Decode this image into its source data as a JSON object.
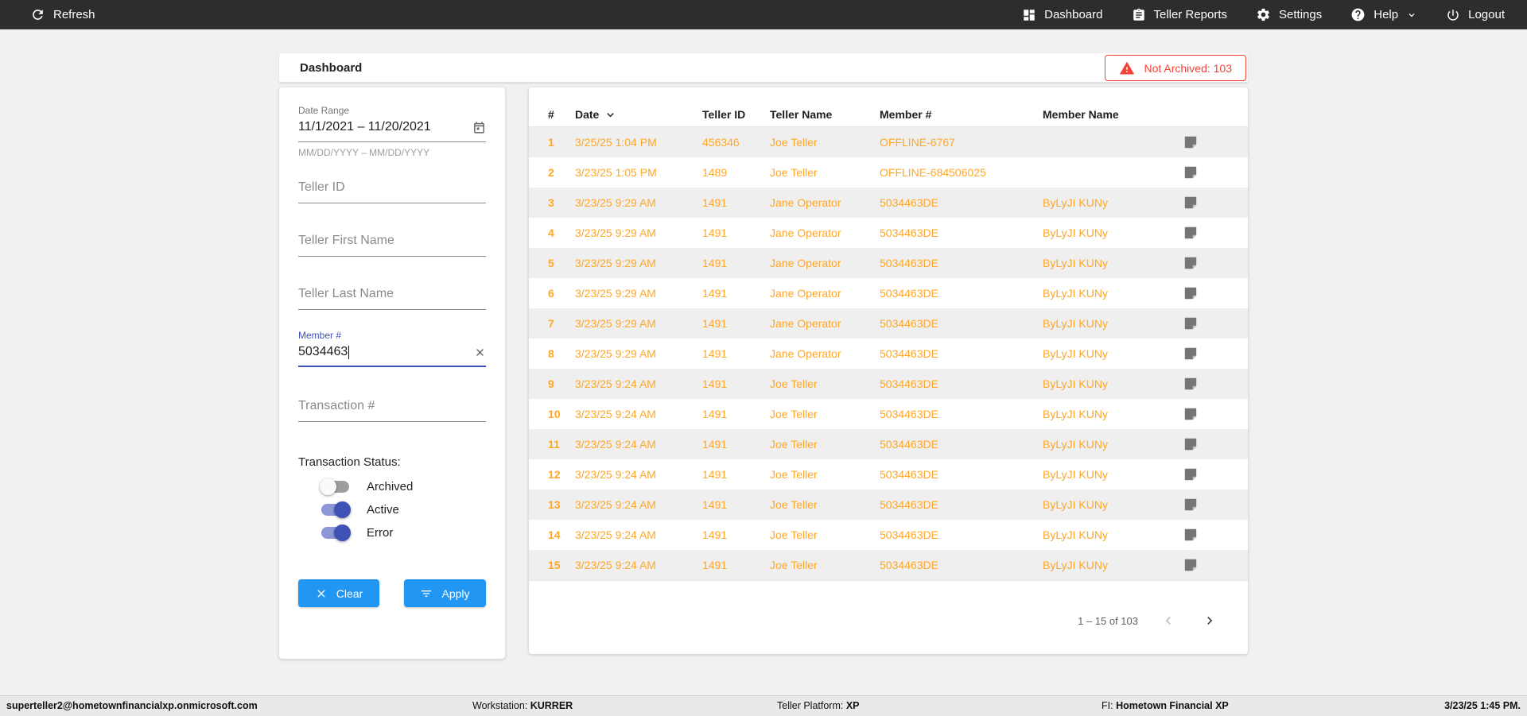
{
  "topbar": {
    "refresh_label": "Refresh",
    "nav": [
      {
        "label": "Dashboard"
      },
      {
        "label": "Teller Reports"
      },
      {
        "label": "Settings"
      },
      {
        "label": "Help"
      },
      {
        "label": "Logout"
      }
    ]
  },
  "header": {
    "title": "Dashboard",
    "alert_text": "Not Archived: 103"
  },
  "filters": {
    "date_range": {
      "label": "Date Range",
      "value": "11/1/2021 – 11/20/2021",
      "hint": "MM/DD/YYYY – MM/DD/YYYY"
    },
    "teller_id_placeholder": "Teller ID",
    "teller_first_name_placeholder": "Teller First Name",
    "teller_last_name_placeholder": "Teller Last Name",
    "member_number": {
      "label": "Member #",
      "value": "5034463"
    },
    "transaction_placeholder": "Transaction #",
    "status_label": "Transaction Status:",
    "toggles": [
      {
        "label": "Archived",
        "on": false
      },
      {
        "label": "Active",
        "on": true
      },
      {
        "label": "Error",
        "on": true
      }
    ],
    "clear_label": "Clear",
    "apply_label": "Apply"
  },
  "table": {
    "columns": [
      "#",
      "Date",
      "Teller ID",
      "Teller Name",
      "Member #",
      "Member Name"
    ],
    "rows": [
      {
        "num": "1",
        "date": "3/25/25 1:04 PM",
        "teller_id": "456346",
        "teller_name": "Joe Teller",
        "member_num": "OFFLINE-6767",
        "member_name": ""
      },
      {
        "num": "2",
        "date": "3/23/25 1:05 PM",
        "teller_id": "1489",
        "teller_name": "Joe Teller",
        "member_num": "OFFLINE-684506025",
        "member_name": ""
      },
      {
        "num": "3",
        "date": "3/23/25 9:29 AM",
        "teller_id": "1491",
        "teller_name": "Jane Operator",
        "member_num": "5034463DE",
        "member_name": "ByLyJI KUNy"
      },
      {
        "num": "4",
        "date": "3/23/25 9:29 AM",
        "teller_id": "1491",
        "teller_name": "Jane Operator",
        "member_num": "5034463DE",
        "member_name": "ByLyJI KUNy"
      },
      {
        "num": "5",
        "date": "3/23/25 9:29 AM",
        "teller_id": "1491",
        "teller_name": "Jane Operator",
        "member_num": "5034463DE",
        "member_name": "ByLyJI KUNy"
      },
      {
        "num": "6",
        "date": "3/23/25 9:29 AM",
        "teller_id": "1491",
        "teller_name": "Jane Operator",
        "member_num": "5034463DE",
        "member_name": "ByLyJI KUNy"
      },
      {
        "num": "7",
        "date": "3/23/25 9:29 AM",
        "teller_id": "1491",
        "teller_name": "Jane Operator",
        "member_num": "5034463DE",
        "member_name": "ByLyJI KUNy"
      },
      {
        "num": "8",
        "date": "3/23/25 9:29 AM",
        "teller_id": "1491",
        "teller_name": "Jane Operator",
        "member_num": "5034463DE",
        "member_name": "ByLyJI KUNy"
      },
      {
        "num": "9",
        "date": "3/23/25 9:24 AM",
        "teller_id": "1491",
        "teller_name": "Joe Teller",
        "member_num": "5034463DE",
        "member_name": "ByLyJI KUNy"
      },
      {
        "num": "10",
        "date": "3/23/25 9:24 AM",
        "teller_id": "1491",
        "teller_name": "Joe Teller",
        "member_num": "5034463DE",
        "member_name": "ByLyJI KUNy"
      },
      {
        "num": "11",
        "date": "3/23/25 9:24 AM",
        "teller_id": "1491",
        "teller_name": "Joe Teller",
        "member_num": "5034463DE",
        "member_name": "ByLyJI KUNy"
      },
      {
        "num": "12",
        "date": "3/23/25 9:24 AM",
        "teller_id": "1491",
        "teller_name": "Joe Teller",
        "member_num": "5034463DE",
        "member_name": "ByLyJI KUNy"
      },
      {
        "num": "13",
        "date": "3/23/25 9:24 AM",
        "teller_id": "1491",
        "teller_name": "Joe Teller",
        "member_num": "5034463DE",
        "member_name": "ByLyJI KUNy"
      },
      {
        "num": "14",
        "date": "3/23/25 9:24 AM",
        "teller_id": "1491",
        "teller_name": "Joe Teller",
        "member_num": "5034463DE",
        "member_name": "ByLyJI KUNy"
      },
      {
        "num": "15",
        "date": "3/23/25 9:24 AM",
        "teller_id": "1491",
        "teller_name": "Joe Teller",
        "member_num": "5034463DE",
        "member_name": "ByLyJI KUNy"
      }
    ],
    "pagination_text": "1 – 15 of 103"
  },
  "statusbar": {
    "user": "superteller2@hometownfinancialxp.onmicrosoft.com",
    "workstation_label": "Workstation: ",
    "workstation_value": "KURRER",
    "platform_label": "Teller Platform: ",
    "platform_value": "XP",
    "fi_label": "FI: ",
    "fi_value": "Hometown Financial XP",
    "datetime": "3/23/25 1:45 PM."
  },
  "colors": {
    "topbar_bg": "#2d2d2d",
    "accent_blue": "#2196f3",
    "toggle_indigo": "#3f51b5",
    "table_text_orange": "#ffa726",
    "alert_red": "#f44336"
  }
}
